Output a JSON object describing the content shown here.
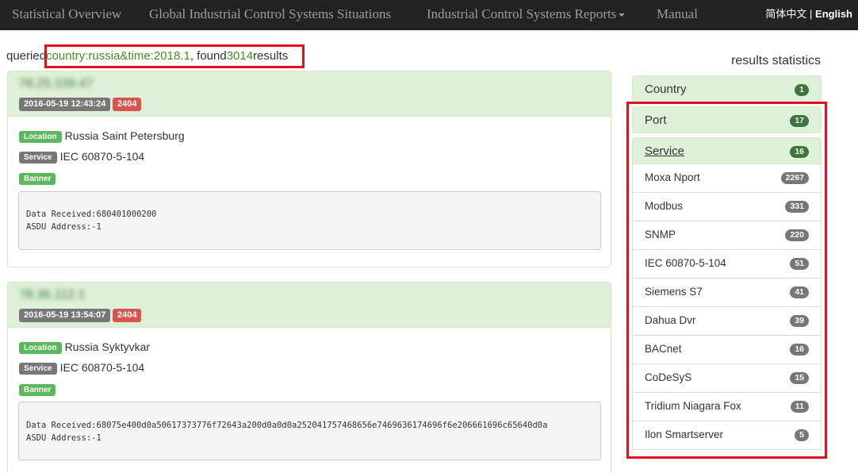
{
  "nav": {
    "items": [
      "Statistical Overview",
      "Global Industrial Control Systems Situations",
      "Industrial Control Systems Reports",
      "Manual"
    ],
    "lang_cn": "简体中文",
    "lang_sep": " | ",
    "lang_en": "English"
  },
  "query": {
    "prefix": "queried",
    "term": "country:russia&time:2018.1",
    "sep": ", found",
    "count": "3014",
    "suffix": "results"
  },
  "results": [
    {
      "ip": "78.25.109.47",
      "time": "2016-05-19 12:43:24",
      "port": "2404",
      "location_label": "Location",
      "location": "Russia Saint Petersburg",
      "service_label": "Service",
      "service": "IEC 60870-5-104",
      "banner_label": "Banner",
      "banner_lines": [
        "Data Received:680401000200",
        "ASDU Address:-1"
      ]
    },
    {
      "ip": "78.36.112.1",
      "time": "2016-05-19 13:54:07",
      "port": "2404",
      "location_label": "Location",
      "location": "Russia Syktyvkar",
      "service_label": "Service",
      "service": "IEC 60870-5-104",
      "banner_label": "Banner",
      "banner_lines": [
        "Data Received:68075e400d0a50617373776f72643a200d0a0d0a252041757468656e7469636174696f6e206661696c65640d0a",
        "ASDU Address:-1"
      ]
    }
  ],
  "sidebar": {
    "title": "results statistics",
    "country": {
      "label": "Country",
      "count": "1"
    },
    "port": {
      "label": "Port",
      "count": "17"
    },
    "service": {
      "label": "Service",
      "count": "16"
    },
    "services": [
      {
        "label": "Moxa Nport",
        "count": "2267"
      },
      {
        "label": "Modbus",
        "count": "331"
      },
      {
        "label": "SNMP",
        "count": "220"
      },
      {
        "label": "IEC 60870-5-104",
        "count": "51"
      },
      {
        "label": "Siemens S7",
        "count": "41"
      },
      {
        "label": "Dahua Dvr",
        "count": "39"
      },
      {
        "label": "BACnet",
        "count": "16"
      },
      {
        "label": "CoDeSyS",
        "count": "15"
      },
      {
        "label": "Tridium Niagara Fox",
        "count": "11"
      },
      {
        "label": "Ilon Smartserver",
        "count": "5"
      }
    ]
  },
  "colors": {
    "highlight": "#e0101e",
    "accent_green": "#4a8a25",
    "panel_green": "#dff0d8"
  }
}
